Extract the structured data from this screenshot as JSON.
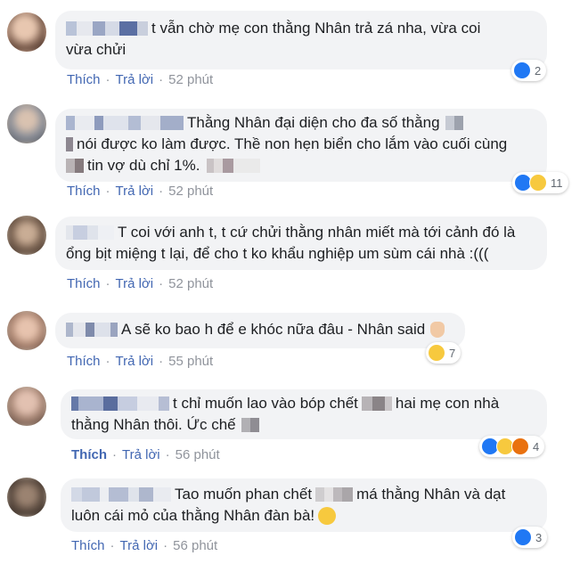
{
  "colors": {
    "bubble": "#f2f3f5",
    "link": "#4267b2",
    "meta": "#90949c",
    "like": "#2078f4",
    "haha": "#f7c93e",
    "angry": "#e9710f"
  },
  "comments": [
    {
      "lines": [
        "t vẫn chờ mẹ con thằng Nhân trả zá nha, vừa coi",
        "vừa chửi"
      ],
      "like": "Thích",
      "reply": "Trả lời",
      "time": "52 phút",
      "reactions": [
        "like"
      ],
      "count": "2"
    },
    {
      "lines": [
        "Thằng Nhân đại diện cho đa số thằng",
        "nói được ko làm được. Thề non hẹn biển cho lắm vào cuối cùng",
        "tin vợ dù chỉ 1%."
      ],
      "like": "Thích",
      "reply": "Trả lời",
      "time": "52 phút",
      "reactions": [
        "like",
        "haha"
      ],
      "count": "11"
    },
    {
      "lines": [
        "T coi với anh t, t cứ chửi thằng nhân miết mà tới cảnh đó là",
        "ổng bịt miệng t lại, để cho t ko khẩu nghiệp um sùm cái nhà :((("
      ],
      "like": "Thích",
      "reply": "Trả lời",
      "time": "52 phút",
      "reactions": [],
      "count": ""
    },
    {
      "lines": [
        "A sẽ ko bao h để e khóc nữa đâu - Nhân said"
      ],
      "like": "Thích",
      "reply": "Trả lời",
      "time": "55 phút",
      "reactions": [
        "haha"
      ],
      "count": "7"
    },
    {
      "lines": [
        "t chỉ muốn lao vào bóp chết",
        "hai mẹ con nhà",
        "thằng Nhân thôi. Ức chế"
      ],
      "like": "Thích",
      "reply": "Trả lời",
      "time": "56 phút",
      "reactions": [
        "like",
        "haha",
        "angry"
      ],
      "count": "4"
    },
    {
      "lines": [
        "Tao muốn phan chết",
        "má thằng Nhân và dạt",
        "luôn cái mỏ của thằng Nhân đàn bà!"
      ],
      "like": "Thích",
      "reply": "Trả lời",
      "time": "56 phút",
      "reactions": [
        "like"
      ],
      "count": "3"
    }
  ]
}
